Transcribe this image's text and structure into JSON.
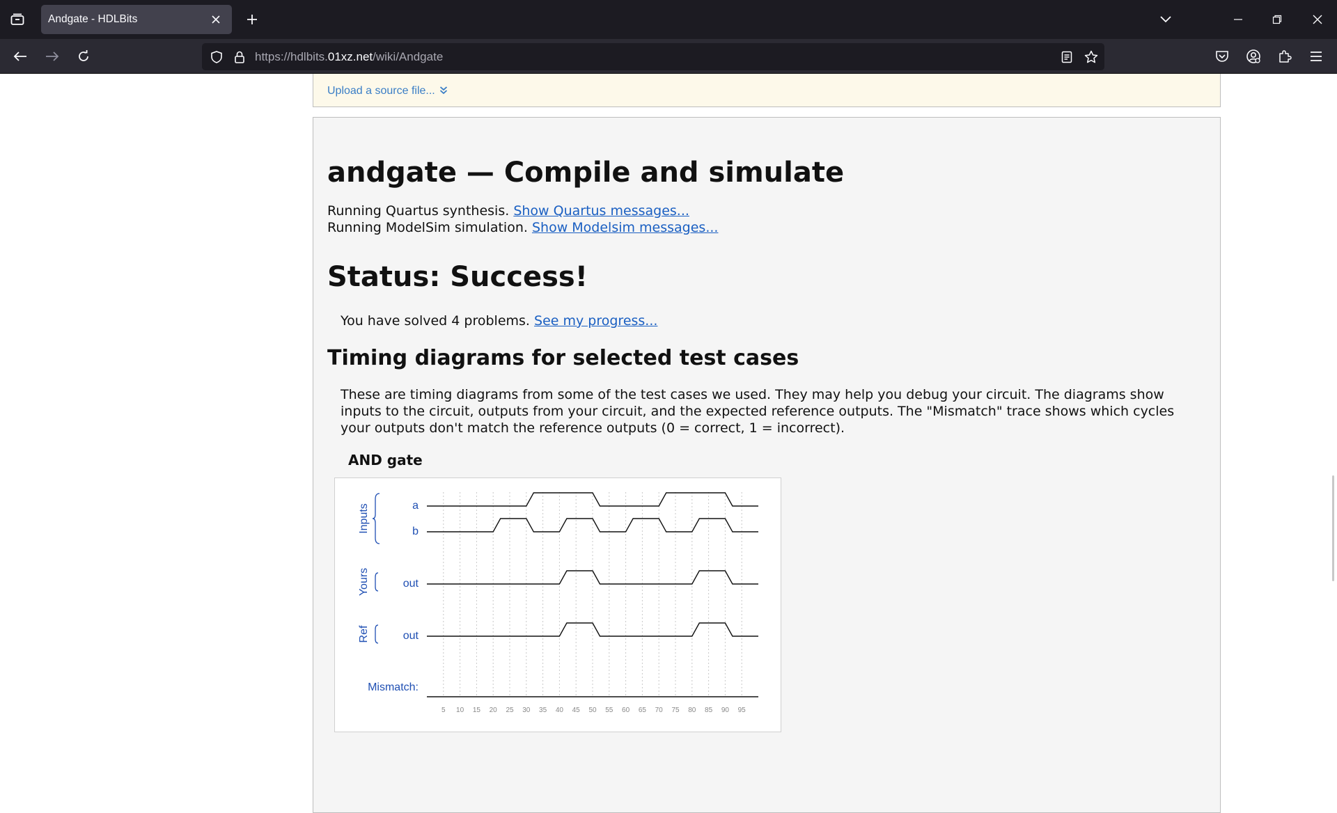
{
  "browser": {
    "tab_title": "Andgate - HDLBits",
    "url_prefix": "https://hdlbits.",
    "url_domain": "01xz.net",
    "url_path": "/wiki/Andgate"
  },
  "upload": {
    "label": "Upload a source file..."
  },
  "result": {
    "title": "andgate — Compile and simulate",
    "quartus_text": "Running Quartus synthesis.",
    "quartus_link": "Show Quartus messages...",
    "modelsim_text": "Running ModelSim simulation.",
    "modelsim_link": "Show Modelsim messages...",
    "status_heading": "Status: Success!",
    "solved_text": "You have solved 4 problems.",
    "progress_link": "See my progress...",
    "timing_heading": "Timing diagrams for selected test cases",
    "timing_description": "These are timing diagrams from some of the test cases we used. They may help you debug your circuit. The diagrams show inputs to the circuit, outputs from your circuit, and the expected reference outputs. The \"Mismatch\" trace shows which cycles your outputs don't match the reference outputs (0 = correct, 1 = incorrect)."
  },
  "waveform": {
    "title": "AND gate",
    "groups": [
      {
        "label": "Inputs",
        "signals": [
          "a",
          "b"
        ]
      },
      {
        "label": "Yours",
        "signals": [
          "out"
        ]
      },
      {
        "label": "Ref",
        "signals": [
          "out"
        ]
      }
    ],
    "mismatch_label": "Mismatch:",
    "time_ticks": [
      "5",
      "10",
      "15",
      "20",
      "25",
      "30",
      "35",
      "40",
      "45",
      "50",
      "55",
      "60",
      "65",
      "70",
      "75",
      "80",
      "85",
      "90",
      "95"
    ],
    "traces": {
      "a": [
        [
          0,
          0
        ],
        [
          30,
          0
        ],
        [
          30,
          1
        ],
        [
          50,
          1
        ],
        [
          50,
          0
        ],
        [
          70,
          0
        ],
        [
          70,
          1
        ],
        [
          90,
          1
        ],
        [
          90,
          0
        ],
        [
          100,
          0
        ]
      ],
      "b": [
        [
          0,
          0
        ],
        [
          20,
          0
        ],
        [
          20,
          1
        ],
        [
          30,
          1
        ],
        [
          30,
          0
        ],
        [
          40,
          0
        ],
        [
          40,
          1
        ],
        [
          50,
          1
        ],
        [
          50,
          0
        ],
        [
          60,
          0
        ],
        [
          60,
          1
        ],
        [
          70,
          1
        ],
        [
          70,
          0
        ],
        [
          80,
          0
        ],
        [
          80,
          1
        ],
        [
          90,
          1
        ],
        [
          90,
          0
        ],
        [
          100,
          0
        ]
      ],
      "yours_out": [
        [
          0,
          0
        ],
        [
          40,
          0
        ],
        [
          40,
          1
        ],
        [
          50,
          1
        ],
        [
          50,
          0
        ],
        [
          80,
          0
        ],
        [
          80,
          1
        ],
        [
          90,
          1
        ],
        [
          90,
          0
        ],
        [
          100,
          0
        ]
      ],
      "ref_out": [
        [
          0,
          0
        ],
        [
          40,
          0
        ],
        [
          40,
          1
        ],
        [
          50,
          1
        ],
        [
          50,
          0
        ],
        [
          80,
          0
        ],
        [
          80,
          1
        ],
        [
          90,
          1
        ],
        [
          90,
          0
        ],
        [
          100,
          0
        ]
      ],
      "mismatch": [
        [
          0,
          0
        ],
        [
          100,
          0
        ]
      ]
    },
    "colors": {
      "label": "#1f4fb3",
      "trace": "#111111",
      "grid": "#c8c8c8",
      "tick": "#888888"
    }
  }
}
